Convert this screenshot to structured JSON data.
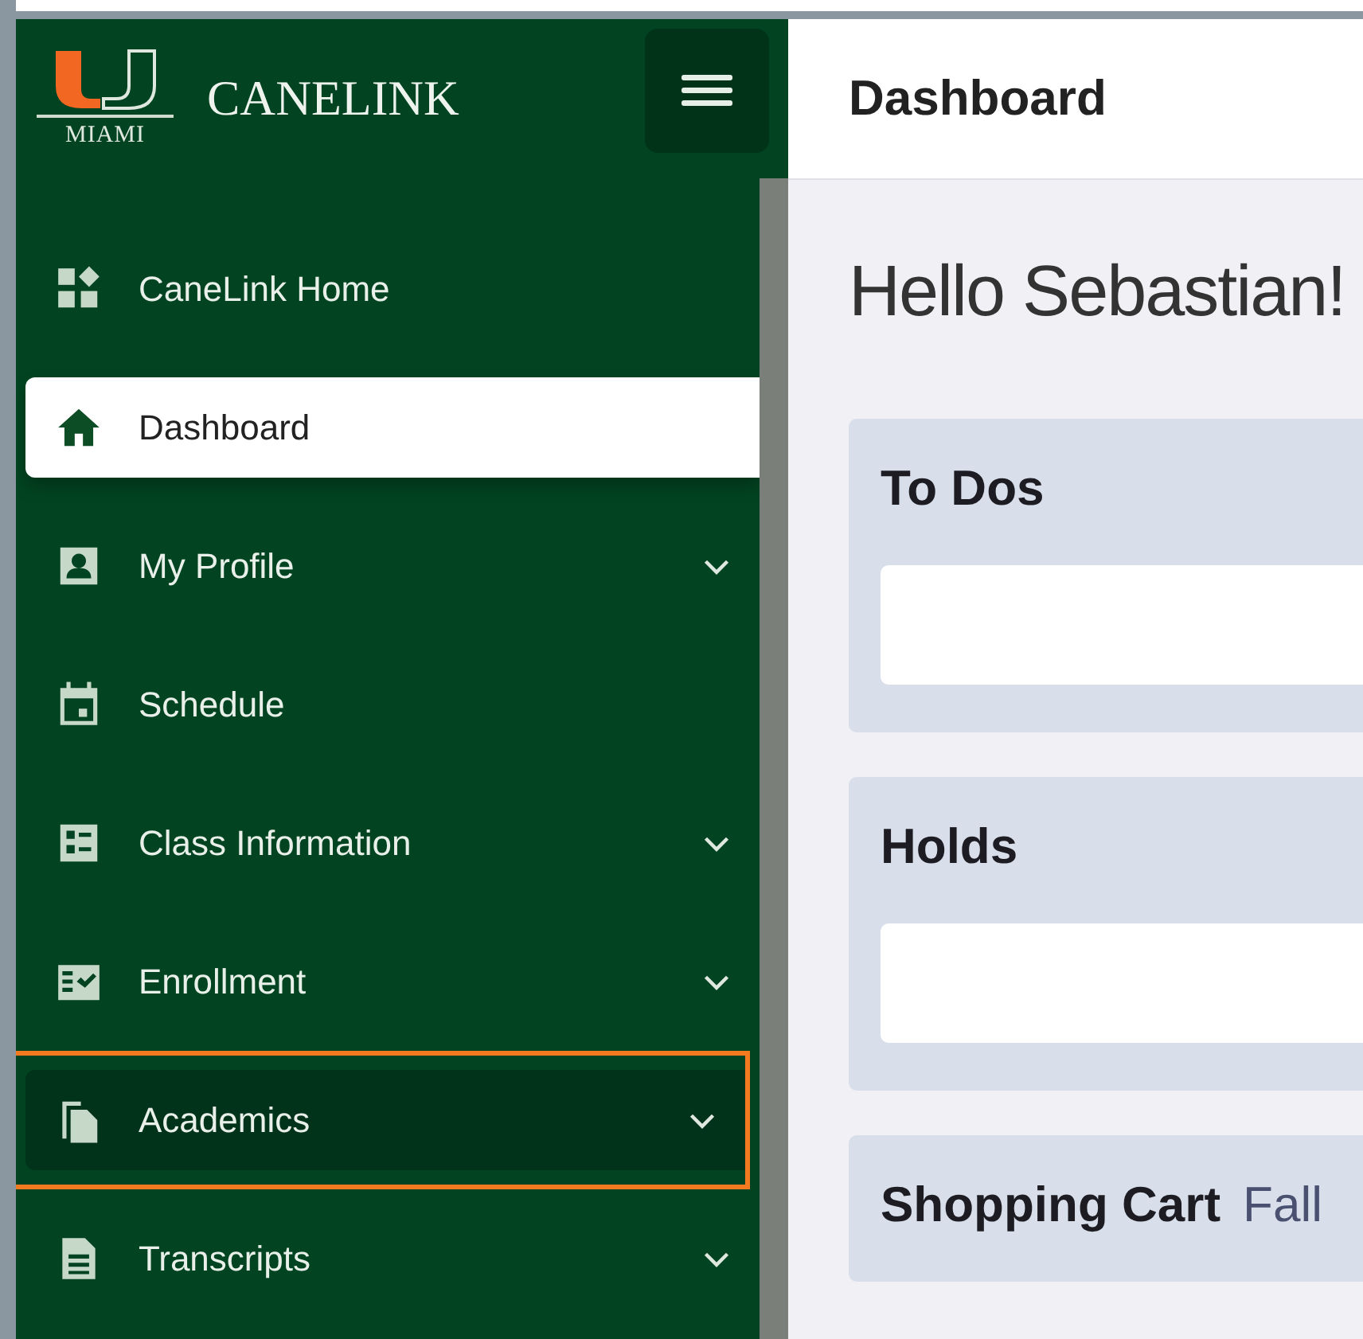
{
  "logo": {
    "mark": "MIAMI",
    "title": "CANELINK"
  },
  "sidebar": {
    "items": [
      {
        "label": "CaneLink Home",
        "selected": false,
        "highlighted": false,
        "expandable": false
      },
      {
        "label": "Dashboard",
        "selected": true,
        "highlighted": false,
        "expandable": false
      },
      {
        "label": "My Profile",
        "selected": false,
        "highlighted": false,
        "expandable": true
      },
      {
        "label": "Schedule",
        "selected": false,
        "highlighted": false,
        "expandable": false
      },
      {
        "label": "Class Information",
        "selected": false,
        "highlighted": false,
        "expandable": true
      },
      {
        "label": "Enrollment",
        "selected": false,
        "highlighted": false,
        "expandable": true
      },
      {
        "label": "Academics",
        "selected": false,
        "highlighted": true,
        "expandable": true
      },
      {
        "label": "Transcripts",
        "selected": false,
        "highlighted": false,
        "expandable": true
      }
    ]
  },
  "page_title": "Dashboard",
  "greeting": "Hello Sebastian!",
  "cards": [
    {
      "title": "To Dos"
    },
    {
      "title": "Holds"
    },
    {
      "title": "Shopping Cart",
      "subtitle": "Fall"
    }
  ]
}
